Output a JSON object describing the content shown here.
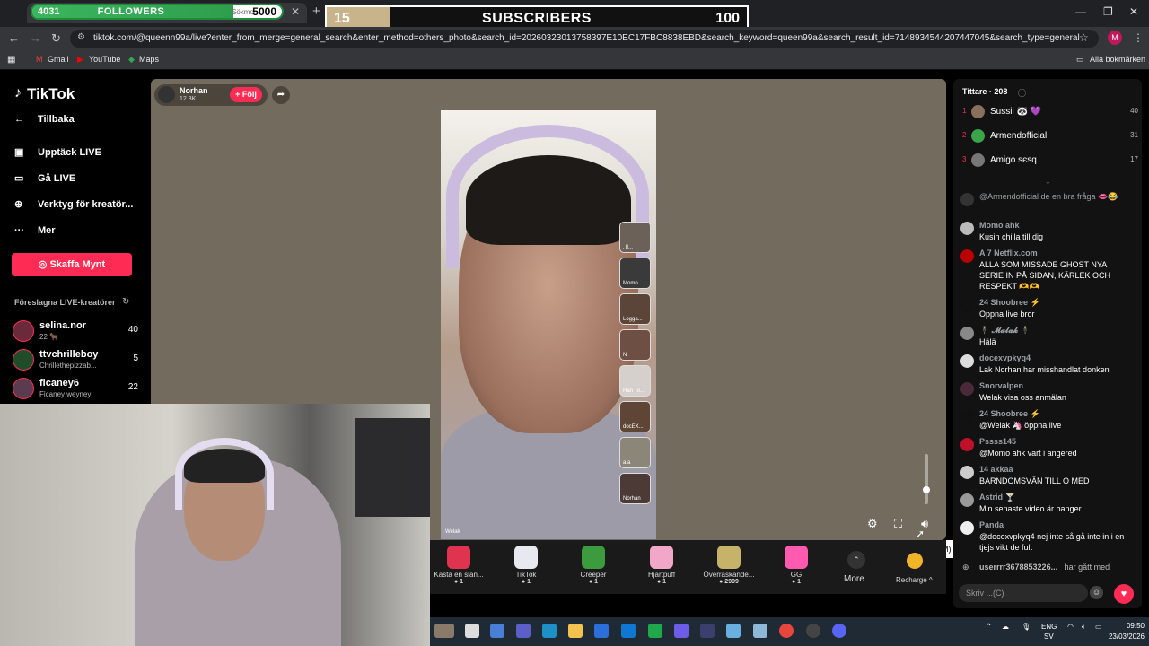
{
  "overlays": {
    "followers": {
      "count": "4031",
      "label": "FOLLOWERS",
      "goal": "5000",
      "hidden_text": "Sökmo",
      "progress_fraction": 0.806
    },
    "subscribers": {
      "count": "15",
      "label": "SUBSCRIBERS",
      "goal": "100",
      "progress_fraction": 0.15
    }
  },
  "browser": {
    "url": "tiktok.com/@queenn99a/live?enter_from_merge=general_search&enter_method=others_photo&search_id=20260323013758397E10EC17FBC8838EBD&search_keyword=queen99a&search_result_id=7148934544207447045&search_type=general",
    "profile_initial": "M",
    "bookmarks": [
      "Gmail",
      "YouTube",
      "Maps"
    ],
    "all_bookmarks": "Alla bokmärken"
  },
  "sidebar": {
    "logo": "TikTok",
    "back": "Tillbaka",
    "items": [
      "Upptäck LIVE",
      "Gå LIVE",
      "Verktyg för kreatör...",
      "Mer"
    ],
    "coins_button": "Skaffa Mynt",
    "suggested_title": "Föreslagna LIVE-kreatörer",
    "creators": [
      {
        "name": "selina.nor",
        "sub": "22 🐂",
        "count": "40"
      },
      {
        "name": "ttvchrilleboy",
        "sub": "Chrillethepizzab...",
        "count": "5"
      },
      {
        "name": "ficaney6",
        "sub": "Ficaney weyney",
        "count": "22"
      }
    ]
  },
  "stream": {
    "host_name": "Norhan",
    "host_likes": "12.3K",
    "follow": "+ Följ",
    "video_tag": "Welak",
    "guests": [
      "ال...",
      "Momo...",
      "Logga...",
      "N",
      "Han To...",
      "docEX...",
      "a.a",
      "Norhan"
    ],
    "tooltip": "Inaktivera (M)",
    "gifts": [
      {
        "name": "Kasta en slän...",
        "price": "1",
        "color": "#e0334f"
      },
      {
        "name": "TikTok",
        "price": "1",
        "color": "#e8e8f0"
      },
      {
        "name": "Creeper",
        "price": "1",
        "color": "#3c9b3c"
      },
      {
        "name": "Hjärtpuff",
        "price": "1",
        "color": "#f2a7c8"
      },
      {
        "name": "Överraskande...",
        "price": "2999",
        "color": "#c7b26a"
      },
      {
        "name": "GG",
        "price": "1",
        "color": "#ff5ab0"
      }
    ],
    "more": "More",
    "recharge": "Recharge ^"
  },
  "chat": {
    "viewers_title": "Tittare · 208",
    "viewers": [
      {
        "rank": "1",
        "name": "Sussii 🐼 💜",
        "score": "40"
      },
      {
        "rank": "2",
        "name": "Armendofficial",
        "score": "31"
      },
      {
        "rank": "3",
        "name": "Amigo ѕєѕq",
        "score": "17"
      }
    ],
    "messages": [
      {
        "user": "@Armendofficial de en bra fråga 👄😂",
        "text": ""
      },
      {
        "user": "Momo ahk",
        "text": "Kusin chilla till dig"
      },
      {
        "user": "A 7 Netflix.com",
        "text": "ALLA SOM MISSADE GHOST NYA SERIE IN PÅ SIDAN, KÄRLEK OCH RESPEKT 🫶🫶"
      },
      {
        "user": "24 Shoobree ⚡",
        "text": "Öppna live bror"
      },
      {
        "user": "🕴 𝓜𝓪𝓵𝓪𝓴 🕴",
        "text": "Hälä"
      },
      {
        "user": "docexvpkyq4",
        "text": "Lak Norhan har misshandlat donken"
      },
      {
        "user": "Snorvalpen",
        "text": "Welak visa oss anmälan"
      },
      {
        "user": "24 Shoobree ⚡",
        "text": "@Welak 🦄 öppna live"
      },
      {
        "user": "Pssss145",
        "text": "@Momo ahk vart i angered"
      },
      {
        "user": "14 akkaa",
        "text": "BARNDOMSVÄN TILL O MED"
      },
      {
        "user": "Astrid 🍸",
        "text": "Min senaste video är banger"
      },
      {
        "user": "Panda",
        "text": "@docexvpkyq4 nej inte så gå inte in i en tjejs vikt de fult"
      }
    ],
    "joined_user": "userrrr3678853226...",
    "joined_text": "har gått med",
    "input_placeholder": "Skriv ...(C)"
  },
  "taskbar": {
    "lang": "ENG",
    "region": "SV",
    "time": "09:50",
    "date": "23/03/2026"
  }
}
